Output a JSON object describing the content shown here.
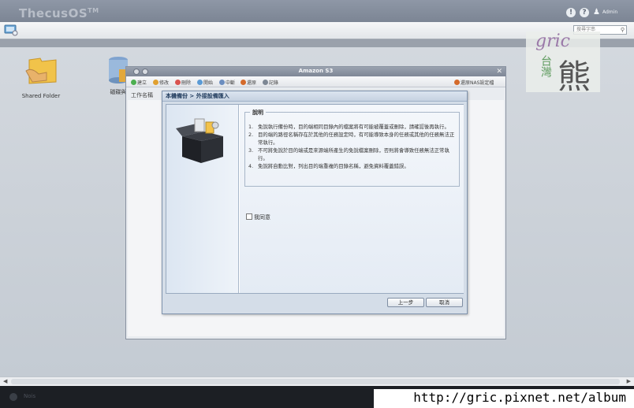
{
  "app": {
    "logo": "ThecusOS",
    "logo_tm": "TM",
    "user_name": "Admin"
  },
  "header": {
    "search_placeholder": "搜尋字串"
  },
  "desktop": {
    "items": [
      {
        "label": "Shared Folder"
      },
      {
        "label": "磁碟與"
      }
    ]
  },
  "watermark": {
    "gric": "gric",
    "taiwan": "台灣",
    "bear": "熊"
  },
  "s3_window": {
    "title": "Amazon S3",
    "toolbar": [
      {
        "label": "建立",
        "color": "#4caf50"
      },
      {
        "label": "修改",
        "color": "#e0a030"
      },
      {
        "label": "刪除",
        "color": "#d9534f"
      },
      {
        "label": "開始",
        "color": "#5b9bd5"
      },
      {
        "label": "中斷",
        "color": "#6c8ebf"
      },
      {
        "label": "還原",
        "color": "#d46a2a"
      },
      {
        "label": "記錄",
        "color": "#7d8794"
      }
    ],
    "restore_label": "還原NAS設定檔",
    "tab_label": "工作名稱"
  },
  "dialog": {
    "title": "本機備份 > 外接設備匯入",
    "legend": "說明",
    "items": [
      "免說執行備份時，目的端相同目錄內的檔案將有可能被覆蓋或刪除，請確認後再執行。",
      "目的端的路徑名稱存在於其他的任務設定時，有可能導致本身的任務或其他的任務無法正常執行。",
      "不可將免說於目的端或是來源端所產生的免說檔案刪除，否則將會導致任務無法正常執行。",
      "免說將自動比對，列出目的端重複的目錄名稱，避免資料覆蓋錯誤。"
    ],
    "numbers": [
      "1.",
      "2.",
      "3.",
      "4."
    ],
    "agree_label": "我同意",
    "prev_button": "上一步",
    "cancel_button": "取消"
  },
  "footer": {
    "text": "Nois",
    "url": "http://gric.pixnet.net/album"
  }
}
